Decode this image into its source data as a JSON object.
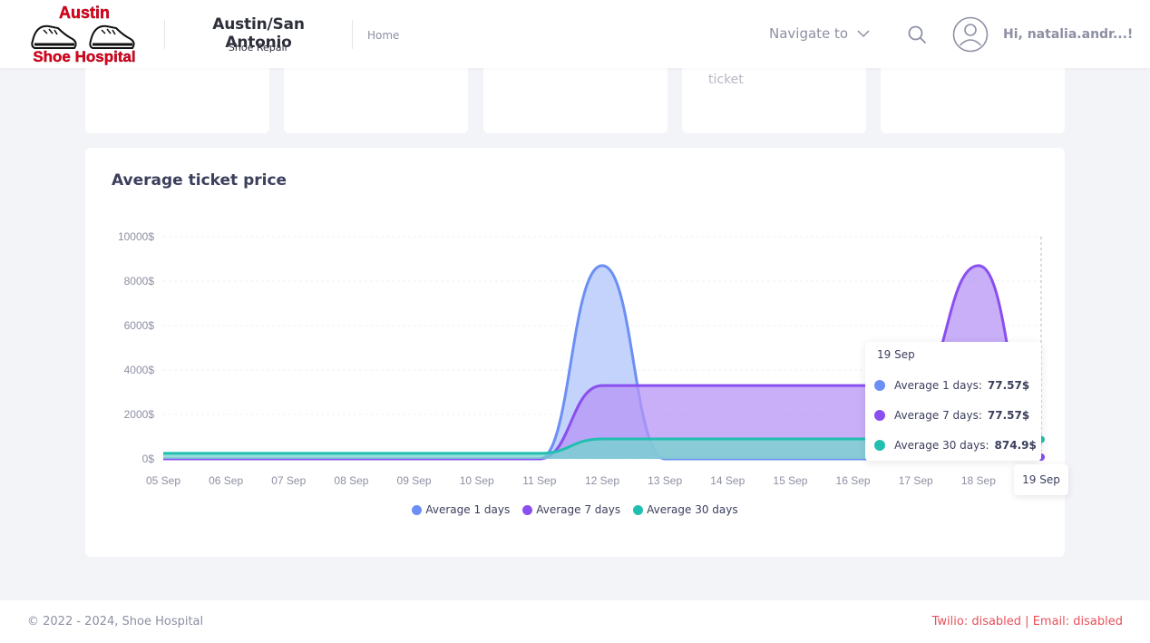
{
  "header": {
    "logo_text_top": "Austin",
    "logo_text_bottom": "Shoe Hospital",
    "brand_title": "Austin/San Antonio",
    "brand_subtitle": "Shoe Repair",
    "breadcrumb_home": "Home",
    "navigate_label": "Navigate to",
    "greeting": "Hi, natalia.andr...!"
  },
  "stat_cards": [
    {
      "text": ""
    },
    {
      "text": ""
    },
    {
      "text": ""
    },
    {
      "text": "ticket"
    },
    {
      "text": ""
    }
  ],
  "panel": {
    "title": "Average ticket price"
  },
  "chart_data": {
    "type": "area",
    "title": "Average ticket price",
    "x": [
      "05 Sep",
      "06 Sep",
      "07 Sep",
      "08 Sep",
      "09 Sep",
      "10 Sep",
      "11 Sep",
      "12 Sep",
      "13 Sep",
      "14 Sep",
      "15 Sep",
      "16 Sep",
      "17 Sep",
      "18 Sep",
      "19 Sep"
    ],
    "y_ticks": [
      "0$",
      "2000$",
      "4000$",
      "6000$",
      "8000$",
      "10000$"
    ],
    "ylim": [
      0,
      10000
    ],
    "series": [
      {
        "name": "Average 1 days",
        "color": "#6b8ff4",
        "fill": "#b0c4fb",
        "values": [
          0,
          0,
          0,
          0,
          0,
          0,
          0,
          8700,
          0,
          0,
          0,
          0,
          0,
          0,
          77.57
        ]
      },
      {
        "name": "Average 7 days",
        "color": "#8a4fef",
        "fill": "#b594f6",
        "values": [
          0,
          0,
          0,
          0,
          0,
          0,
          0,
          3300,
          3300,
          3300,
          3300,
          3300,
          3300,
          8700,
          77.57
        ]
      },
      {
        "name": "Average 30 days",
        "color": "#22bfb0",
        "fill": "#74d6cd",
        "values": [
          250,
          250,
          250,
          250,
          250,
          250,
          250,
          900,
          900,
          900,
          900,
          900,
          900,
          900,
          874.9
        ]
      }
    ],
    "grid": true,
    "legend": "bottom-center"
  },
  "tooltip": {
    "date": "19 Sep",
    "rows": [
      {
        "label": "Average 1 days:",
        "value": "77.57$",
        "color": "#6b8ff4"
      },
      {
        "label": "Average 7 days:",
        "value": "77.57$",
        "color": "#8a4fef"
      },
      {
        "label": "Average 30 days:",
        "value": "874.9$",
        "color": "#22bfb0"
      }
    ],
    "x_label": "19 Sep"
  },
  "footer": {
    "copyright": "© 2022 - 2024,  Shoe Hospital",
    "status": "Twilio: disabled | Email: disabled"
  }
}
